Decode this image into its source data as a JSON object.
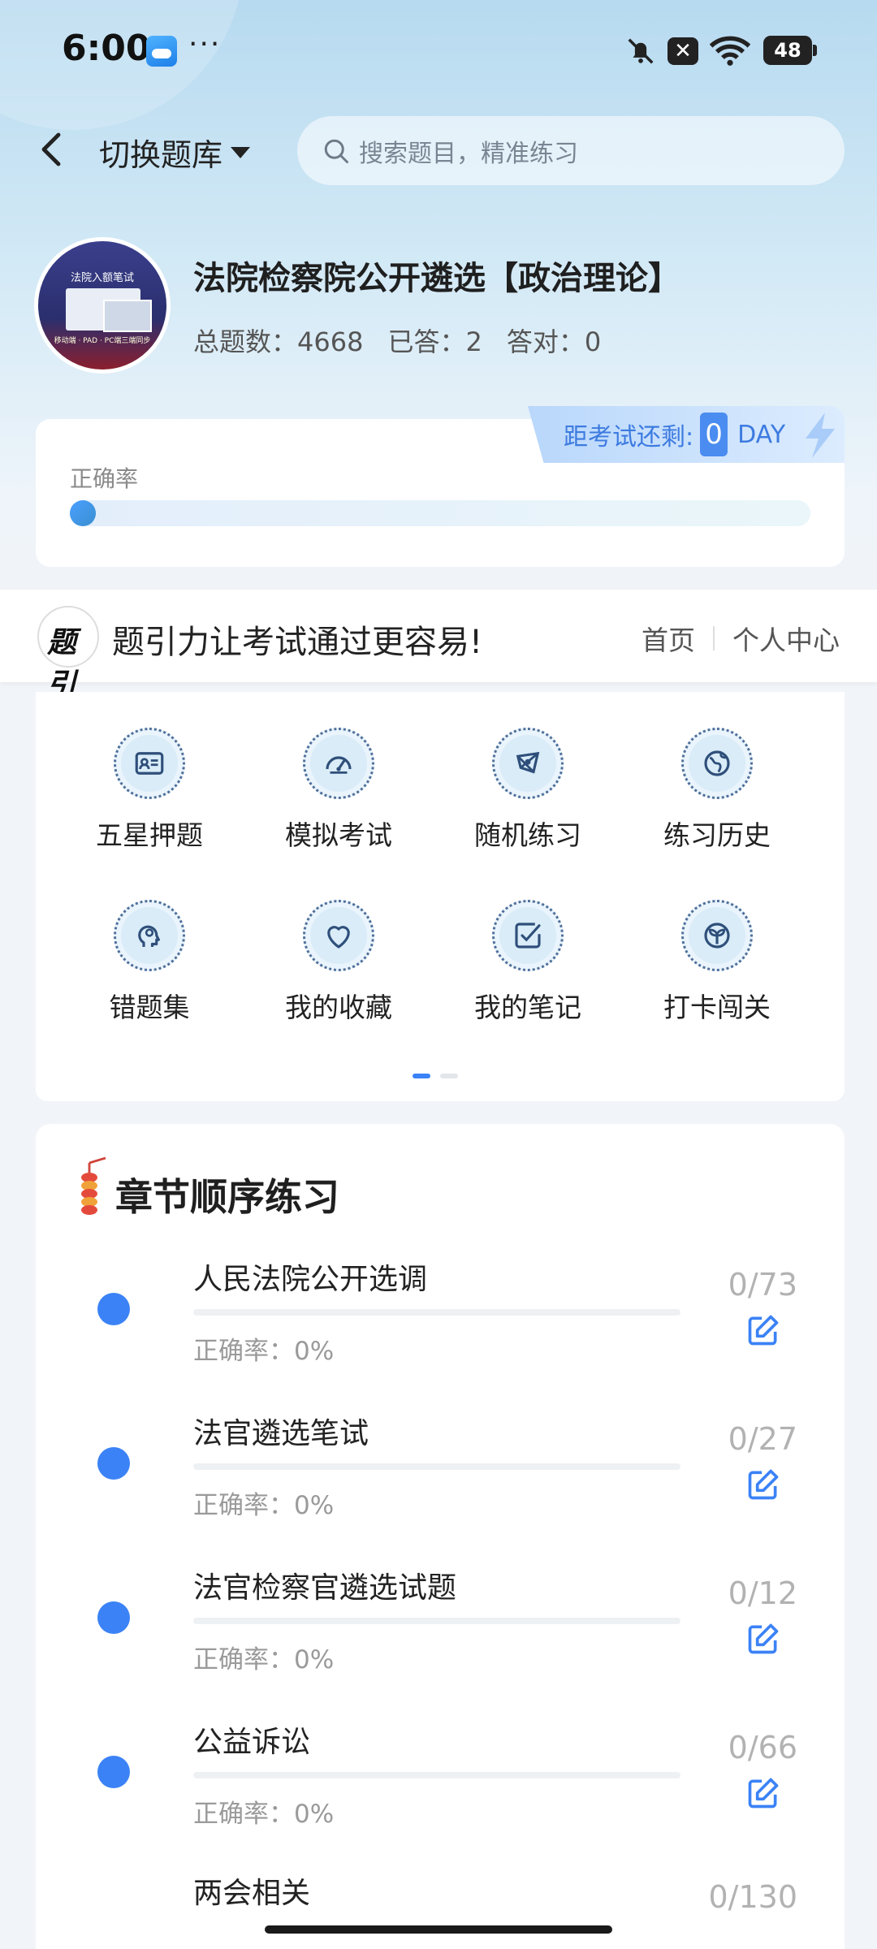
{
  "status_bar": {
    "time": "6:00",
    "more": "···",
    "notif_x": "✕",
    "battery": "48",
    "icons": [
      "weather-icon",
      "bell-muted-icon",
      "close-box-icon",
      "wifi-icon",
      "battery-icon"
    ]
  },
  "header": {
    "switch_label": "切换题库",
    "search_placeholder": "搜索题目，精准练习"
  },
  "bank": {
    "avatar_title": "法院入额笔试",
    "avatar_footer": "移动端 · PAD · PC端三端同步",
    "title": "法院检察院公开遴选【政治理论】",
    "total_label": "总题数：4668",
    "answered_label": "已答：2",
    "correct_label": "答对：0"
  },
  "countdown": {
    "label": "距考试还剩:",
    "value": "0",
    "unit": "DAY"
  },
  "accuracy": {
    "label": "正确率",
    "value_fraction": 0
  },
  "promo": {
    "logo_text": "题引",
    "slogan": "题引力让考试通过更容易!",
    "link_home": "首页",
    "link_profile": "个人中心"
  },
  "features": [
    {
      "label": "五星押题",
      "icon": "id-card-icon"
    },
    {
      "label": "模拟考试",
      "icon": "speedometer-icon"
    },
    {
      "label": "随机练习",
      "icon": "network-icon"
    },
    {
      "label": "练习历史",
      "icon": "globe-icon"
    },
    {
      "label": "错题集",
      "icon": "head-icon"
    },
    {
      "label": "我的收藏",
      "icon": "heart-icon"
    },
    {
      "label": "我的笔记",
      "icon": "checkbox-icon"
    },
    {
      "label": "打卡闯关",
      "icon": "sprout-icon"
    }
  ],
  "pager": {
    "current": 1,
    "total": 2
  },
  "chapters": {
    "title": "章节顺序练习",
    "items": [
      {
        "name": "人民法院公开选调",
        "rate": "正确率：0%",
        "count": "0/73"
      },
      {
        "name": "法官遴选笔试",
        "rate": "正确率：0%",
        "count": "0/27"
      },
      {
        "name": "法官检察官遴选试题",
        "rate": "正确率：0%",
        "count": "0/12"
      },
      {
        "name": "公益诉讼",
        "rate": "正确率：0%",
        "count": "0/66"
      },
      {
        "name": "两会相关",
        "rate": "",
        "count": "0/130"
      }
    ]
  },
  "colors": {
    "accent": "#3b82f6",
    "countdown_text": "#3d7be0",
    "muted_text": "#9a9a9a"
  }
}
